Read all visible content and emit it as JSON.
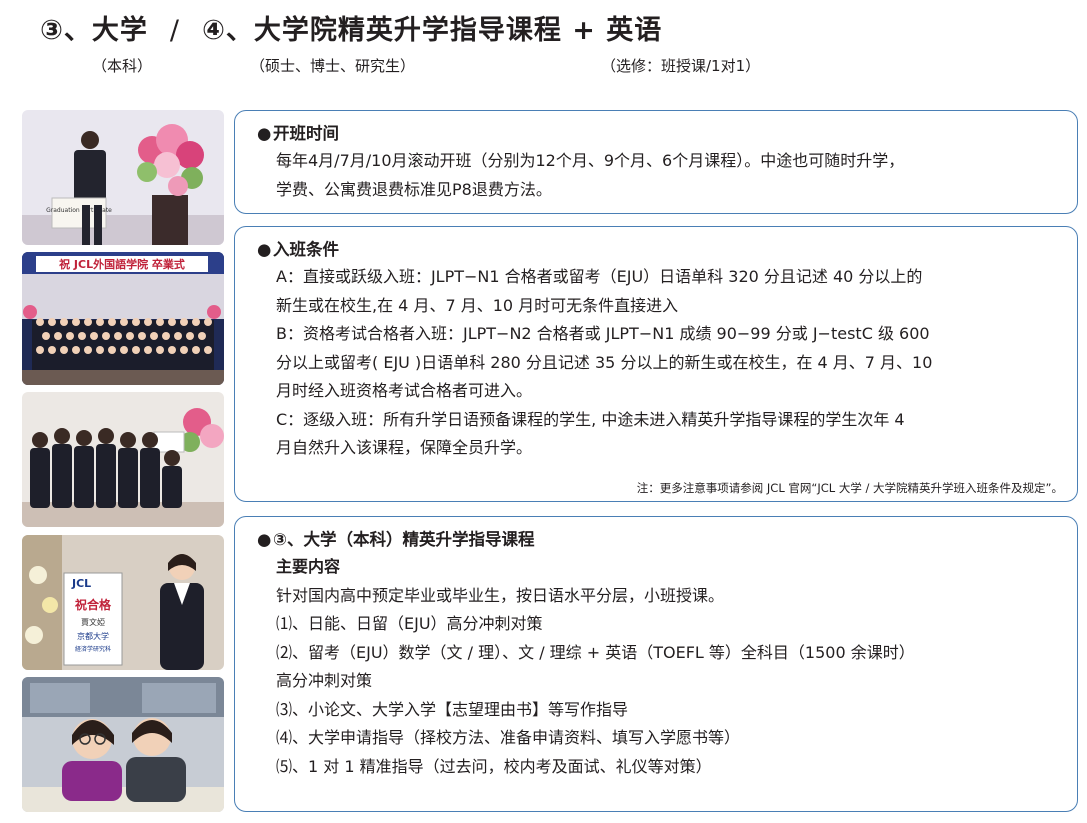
{
  "header": {
    "title_part1": "③、大学",
    "title_sep": "/",
    "title_part2": "④、大学院精英升学指导课程 + 英语",
    "sub1": "（本科）",
    "sub2": "（硕士、博士、研究生）",
    "sub3": "（选修：班授课/1对1）"
  },
  "photos": {
    "p1_sign": "Graduation certificate",
    "p2_banner": "祝 JCL外国語学院 卒業式",
    "p4_sign_title": "祝合格",
    "p4_sign_name": "賈文婭",
    "p4_sign_school": "京都大学",
    "p4_sign_dept": "経済学研究科",
    "p4_logo": "JCL"
  },
  "box1": {
    "bullet": "●",
    "heading": "开班时间",
    "lines": [
      "每年4月/7月/10月滚动开班（分别为12个月、9个月、6个月课程）。中途也可随时升学，",
      "学费、公寓费退费标准见P8退费方法。"
    ]
  },
  "box2": {
    "bullet": "●",
    "heading": "入班条件",
    "lines": [
      "A：直接或跃级入班：JLPT−N1 合格者或留考（EJU）日语单科 320 分且记述 40 分以上的",
      "新生或在校生,在 4 月、7 月、10 月时可无条件直接进入",
      "B：资格考试合格者入班：JLPT−N2 合格者或 JLPT−N1 成绩 90−99 分或 J−testC 级 600",
      "分以上或留考( EJU )日语单科 280 分且记述 35 分以上的新生或在校生，在 4 月、7 月、10",
      "月时经入班资格考试合格者可进入。",
      "C：逐级入班：所有升学日语预备课程的学生, 中途未进入精英升学指导课程的学生次年 4",
      "月自然升入该课程，保障全员升学。"
    ],
    "note": "注：更多注意事项请参阅 JCL 官网“JCL 大学 / 大学院精英升学班入班条件及规定”。"
  },
  "box3": {
    "bullet": "●",
    "heading": "③、大学（本科）精英升学指导课程",
    "subheading": "主要内容",
    "lines": [
      "针对国内高中预定毕业或毕业生，按日语水平分层，小班授课。",
      "⑴、日能、日留（EJU）高分冲刺对策",
      "⑵、留考（EJU）数学（文 / 理）、文 / 理综 + 英语（TOEFL 等）全科目（1500 余课时）",
      "高分冲刺对策",
      "⑶、小论文、大学入学【志望理由书】等写作指导",
      "⑷、大学申请指导（择校方法、准备申请资料、填写入学愿书等）",
      "⑸、1 对 1 精准指导（过去问，校内考及面试、礼仪等对策）"
    ]
  },
  "colors": {
    "border": "#4a7fb5",
    "text": "#231f20"
  }
}
